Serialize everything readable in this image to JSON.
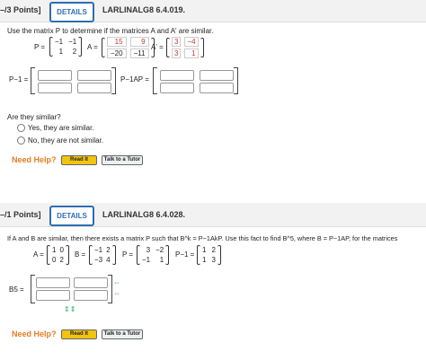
{
  "q1": {
    "points": "–/3 Points]",
    "details_label": "DETAILS",
    "id": "LARLINALG8 6.4.019.",
    "instruction": "Use the matrix P to determine if the matrices A and A' are similar.",
    "p_label": "P =",
    "p": [
      "−1",
      "−1",
      "1",
      "2"
    ],
    "a_label": "A =",
    "a": [
      "15",
      "9",
      "−20",
      "−11"
    ],
    "aprime_label": "A' =",
    "aprime": [
      "3",
      "−4",
      "3",
      "1"
    ],
    "pinv_label": "P−1 =",
    "pinvap_label": "P−1AP =",
    "question": "Are they similar?",
    "opt_yes": "Yes, they are similar.",
    "opt_no": "No, they are not similar.",
    "need_help": "Need Help?",
    "read_it": "Read It",
    "talk_tutor": "Talk to a Tutor"
  },
  "q2": {
    "points": "–/1 Points]",
    "details_label": "DETAILS",
    "id": "LARLINALG8 6.4.028.",
    "instruction": "If A and B are similar, then there exists a matrix P such that B^k = P−1AkP. Use this fact to find B^5, where B = P−1AP, for the matrices",
    "a_label": "A =",
    "a": [
      "1",
      "0",
      "0",
      "2"
    ],
    "b_label": "B =",
    "b": [
      "−1",
      "2",
      "−3",
      "4"
    ],
    "p_label": "P =",
    "p": [
      "3",
      "−2",
      "−1",
      "1"
    ],
    "pinv_label": "P−1 =",
    "pinv": [
      "1",
      "2",
      "1",
      "3"
    ],
    "b5_label": "B5 =",
    "need_help": "Need Help?",
    "read_it": "Read It",
    "talk_tutor": "Talk to a Tutor"
  }
}
